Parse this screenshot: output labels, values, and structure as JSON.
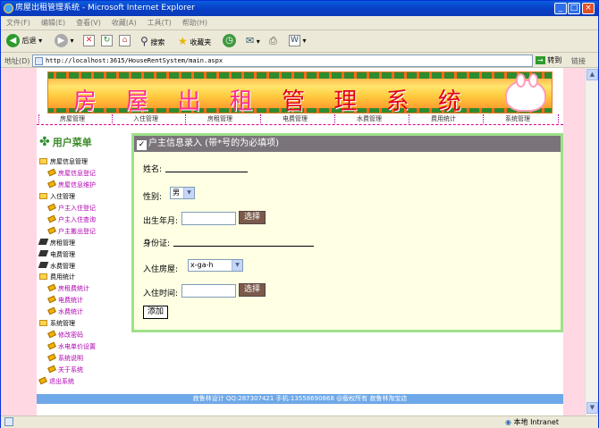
{
  "window": {
    "title": "房屋出租管理系统 - Microsoft Internet Explorer",
    "min": "_",
    "max": "□",
    "close": "×"
  },
  "menubar": [
    "文件(F)",
    "编辑(E)",
    "查看(V)",
    "收藏(A)",
    "工具(T)",
    "帮助(H)"
  ],
  "toolbar": {
    "back": "后退",
    "search": "搜索",
    "favorites": "收藏夹"
  },
  "address": {
    "label": "地址(D)",
    "url": "http://localhost:3615/HouseRentSystem/main.aspx",
    "go": "转到",
    "links": "链接"
  },
  "banner": {
    "part1": "房 屋 出 租",
    "part2": "管 理 系 统"
  },
  "nav": [
    "房屋管理",
    "入住管理",
    "房租管理",
    "电费管理",
    "水费管理",
    "费用统计",
    "系统管理"
  ],
  "sidebar": {
    "header": "用户菜单",
    "items": [
      {
        "label": "房屋信息管理",
        "kind": "folder"
      },
      {
        "label": "房屋信息登记",
        "kind": "sub"
      },
      {
        "label": "房屋信息维护",
        "kind": "sub"
      },
      {
        "label": "入住管理",
        "kind": "folder"
      },
      {
        "label": "户主入住登记",
        "kind": "sub"
      },
      {
        "label": "户主入住查询",
        "kind": "sub"
      },
      {
        "label": "户主搬出登记",
        "kind": "sub"
      },
      {
        "label": "房租管理",
        "kind": "book"
      },
      {
        "label": "电费管理",
        "kind": "book"
      },
      {
        "label": "水费管理",
        "kind": "book"
      },
      {
        "label": "费用统计",
        "kind": "folder"
      },
      {
        "label": "房租费统计",
        "kind": "sub"
      },
      {
        "label": "电费统计",
        "kind": "sub"
      },
      {
        "label": "水费统计",
        "kind": "sub"
      },
      {
        "label": "系统管理",
        "kind": "folder"
      },
      {
        "label": "修改密码",
        "kind": "sub"
      },
      {
        "label": "水电单价设置",
        "kind": "sub"
      },
      {
        "label": "系统说明",
        "kind": "sub"
      },
      {
        "label": "关于系统",
        "kind": "sub"
      },
      {
        "label": "退出系统",
        "kind": "exit"
      }
    ]
  },
  "form": {
    "title": "户主信息录入 (带*号的为必填项)",
    "name_label": "姓名:",
    "gender_label": "性别:",
    "gender_value": "男",
    "birth_label": "出生年月:",
    "select_btn": "选择",
    "id_label": "身份证:",
    "house_label": "入住房屋:",
    "house_value": "x-ga-h",
    "time_label": "入住时间:",
    "select_btn2": "选择",
    "add_btn": "添加"
  },
  "footer": "寂鲁林设计 QQ:287307421 手机:13558690868 @版权所有 寂鲁林淘宝店",
  "status": {
    "zone": "本地 Intranet"
  }
}
